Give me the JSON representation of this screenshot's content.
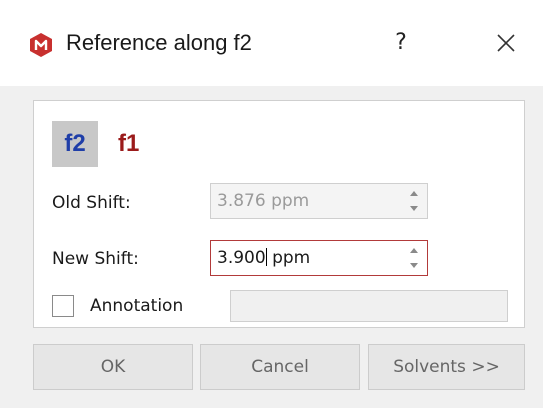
{
  "window": {
    "title": "Reference along f2",
    "help_label": "?",
    "app_icon": "mnova-logo-icon",
    "accent_color": "#c8302f"
  },
  "dimensions": {
    "f2_label": "f2",
    "f1_label": "f1",
    "selected": "f2",
    "f2_color": "#1f3ea8",
    "f1_color": "#9b1b1b"
  },
  "old_shift": {
    "label": "Old Shift:",
    "value": "3.876 ppm",
    "enabled": false
  },
  "new_shift": {
    "label": "New Shift:",
    "value_number": "3.900",
    "value_unit": " ppm"
  },
  "annotation": {
    "label": "Annotation",
    "checked": false,
    "value": ""
  },
  "buttons": {
    "ok": "OK",
    "cancel": "Cancel",
    "solvents": "Solvents >>"
  }
}
